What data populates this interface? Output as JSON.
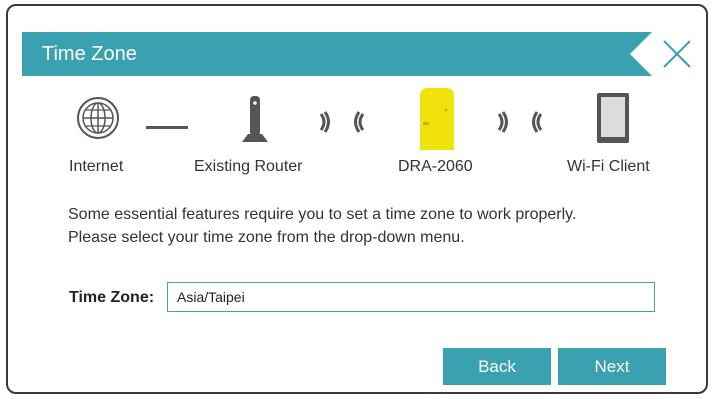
{
  "dialog": {
    "title": "Time Zone",
    "accent_color": "#3aa1b1"
  },
  "topology": {
    "nodes": [
      {
        "label": "Internet",
        "icon": "globe-icon"
      },
      {
        "label": "Existing Router",
        "icon": "router-icon"
      },
      {
        "label": "DRA-2060",
        "icon": "extender-device-icon"
      },
      {
        "label": "Wi-Fi Client",
        "icon": "tablet-icon"
      }
    ]
  },
  "message": {
    "line1": "Some essential features require you to set a time zone to work properly.",
    "line2": "Please select your time zone from the drop-down menu."
  },
  "form": {
    "time_zone_label": "Time Zone:",
    "time_zone_value": "Asia/Taipei"
  },
  "buttons": {
    "back": "Back",
    "next": "Next"
  }
}
